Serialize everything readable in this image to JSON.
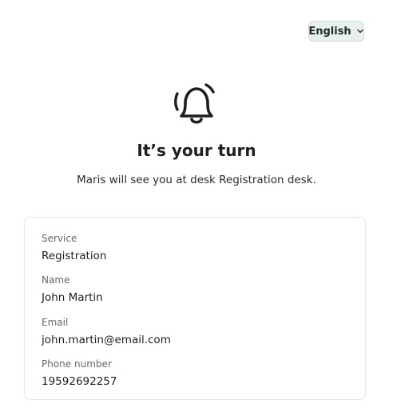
{
  "language_selector": {
    "label": "English",
    "icon": "chevron-down-icon"
  },
  "header": {
    "icon": "bell-ringing-icon",
    "title": "It’s your turn",
    "subtitle": "Maris will see you at desk Registration desk."
  },
  "details": [
    {
      "label": "Service",
      "value": "Registration"
    },
    {
      "label": "Name",
      "value": "John Martin"
    },
    {
      "label": "Email",
      "value": "john.martin@email.com"
    },
    {
      "label": "Phone number",
      "value": "19592692257"
    }
  ],
  "colors": {
    "language_button_bg": "#e7f0ed",
    "language_button_border": "#c9dcd6",
    "text": "#1f1f1f",
    "muted_text": "#666666",
    "card_border": "#e6e6e6"
  }
}
